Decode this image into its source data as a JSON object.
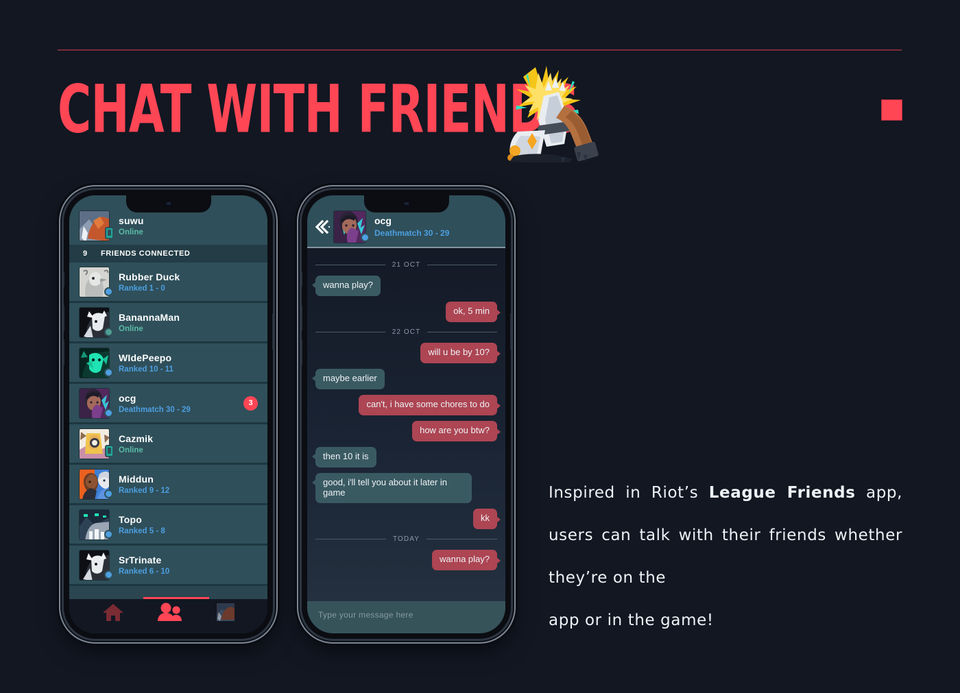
{
  "page": {
    "background": "#121722",
    "accent": "#ff4655",
    "rule_color": "#7e2a3a"
  },
  "headline": {
    "text": "CHAT WITH FRIENDS",
    "color": "#ff4655"
  },
  "decor": {
    "red_square_name": "red-square-marker",
    "illustration_name": "fist-bump-illustration"
  },
  "friends_screen": {
    "me": {
      "name": "suwu",
      "status": "Online",
      "status_kind": "mobile"
    },
    "connected_bar": {
      "count": "9",
      "label": "FRIENDS CONNECTED"
    },
    "friends": [
      {
        "name": "Rubber Duck",
        "status": "Ranked 1 - 0",
        "status_kind": "ranked",
        "unread": ""
      },
      {
        "name": "BanannaMan",
        "status": "Online",
        "status_kind": "online",
        "unread": ""
      },
      {
        "name": "WIdePeepo",
        "status": "Ranked 10 - 11",
        "status_kind": "ranked",
        "unread": ""
      },
      {
        "name": "ocg",
        "status": "Deathmatch 30 - 29",
        "status_kind": "ingame",
        "unread": "3"
      },
      {
        "name": "Cazmik",
        "status": "Online",
        "status_kind": "mobile",
        "unread": ""
      },
      {
        "name": "Middun",
        "status": "Ranked 9 - 12",
        "status_kind": "ranked",
        "unread": ""
      },
      {
        "name": "Topo",
        "status": "Ranked 5 - 8",
        "status_kind": "ranked",
        "unread": ""
      },
      {
        "name": "SrTrinate",
        "status": "Ranked 6 - 10",
        "status_kind": "ranked",
        "unread": ""
      }
    ],
    "tabs": [
      {
        "icon": "home-icon",
        "active": false
      },
      {
        "icon": "friends-icon",
        "active": true
      },
      {
        "icon": "profile-avatar-icon",
        "active": false
      }
    ]
  },
  "chat_screen": {
    "header": {
      "back_icon": "back-chevron-icon",
      "name": "ocg",
      "status": "Deathmatch 30 - 29"
    },
    "thread": [
      {
        "kind": "date",
        "text": "21 OCT"
      },
      {
        "kind": "them",
        "text": "wanna play?"
      },
      {
        "kind": "me",
        "text": "ok, 5 min"
      },
      {
        "kind": "date",
        "text": "22 OCT"
      },
      {
        "kind": "me",
        "text": "will u be by 10?"
      },
      {
        "kind": "them",
        "text": "maybe earlier"
      },
      {
        "kind": "me",
        "text": "can't, i have some chores to do"
      },
      {
        "kind": "me",
        "text": "how are you btw?"
      },
      {
        "kind": "them",
        "text": "then 10 it is"
      },
      {
        "kind": "them",
        "text": "good, i'll tell you about it later in game"
      },
      {
        "kind": "me",
        "text": "kk"
      },
      {
        "kind": "date",
        "text": "TODAY"
      },
      {
        "kind": "me",
        "text": "wanna play?"
      }
    ],
    "composer": {
      "placeholder": "Type your message here",
      "value": ""
    }
  },
  "description": {
    "line1_pre": "Inspired in Riot’s ",
    "line1_bold": "League Friends",
    "rest": " app, users can talk with their friends whether they’re on the ",
    "lastline": "app or in the game!"
  }
}
